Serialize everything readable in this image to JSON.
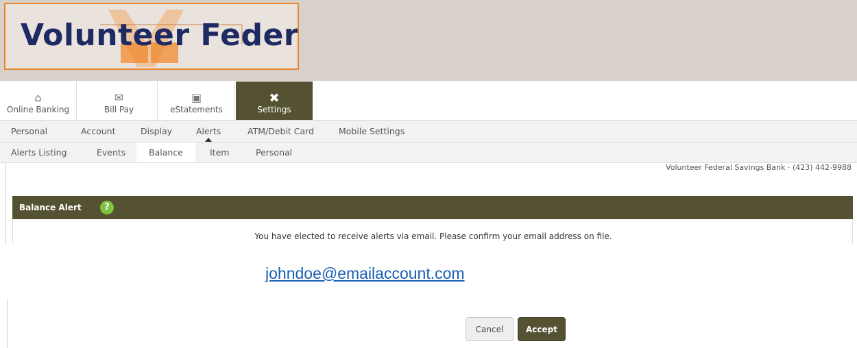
{
  "brand": {
    "logo_text": "Volunteer Federal",
    "accent_color": "#545233",
    "logo_border_color": "#e7862a"
  },
  "top_nav": [
    {
      "label": "Online Banking",
      "icon": "home-icon"
    },
    {
      "label": "Bill Pay",
      "icon": "bill-pay-icon"
    },
    {
      "label": "eStatements",
      "icon": "briefcase-icon"
    },
    {
      "label": "Settings",
      "icon": "tools-icon",
      "active": true
    }
  ],
  "settings_nav": [
    "Personal",
    "Account",
    "Display",
    "Alerts",
    "ATM/Debit Card",
    "Mobile Settings"
  ],
  "settings_active": "Alerts",
  "alerts_nav": [
    "Alerts Listing",
    "Events",
    "Balance",
    "Item",
    "Personal"
  ],
  "alerts_active": "Balance",
  "bank_info": "Volunteer Federal Savings Bank · (423) 442-9988",
  "panel": {
    "title": "Balance Alert",
    "help_label": "?",
    "message": "You have elected to receive alerts via email. Please confirm your email address on file."
  },
  "email": "johndoe@emailaccount.com",
  "buttons": {
    "cancel": "Cancel",
    "accept": "Accept"
  }
}
